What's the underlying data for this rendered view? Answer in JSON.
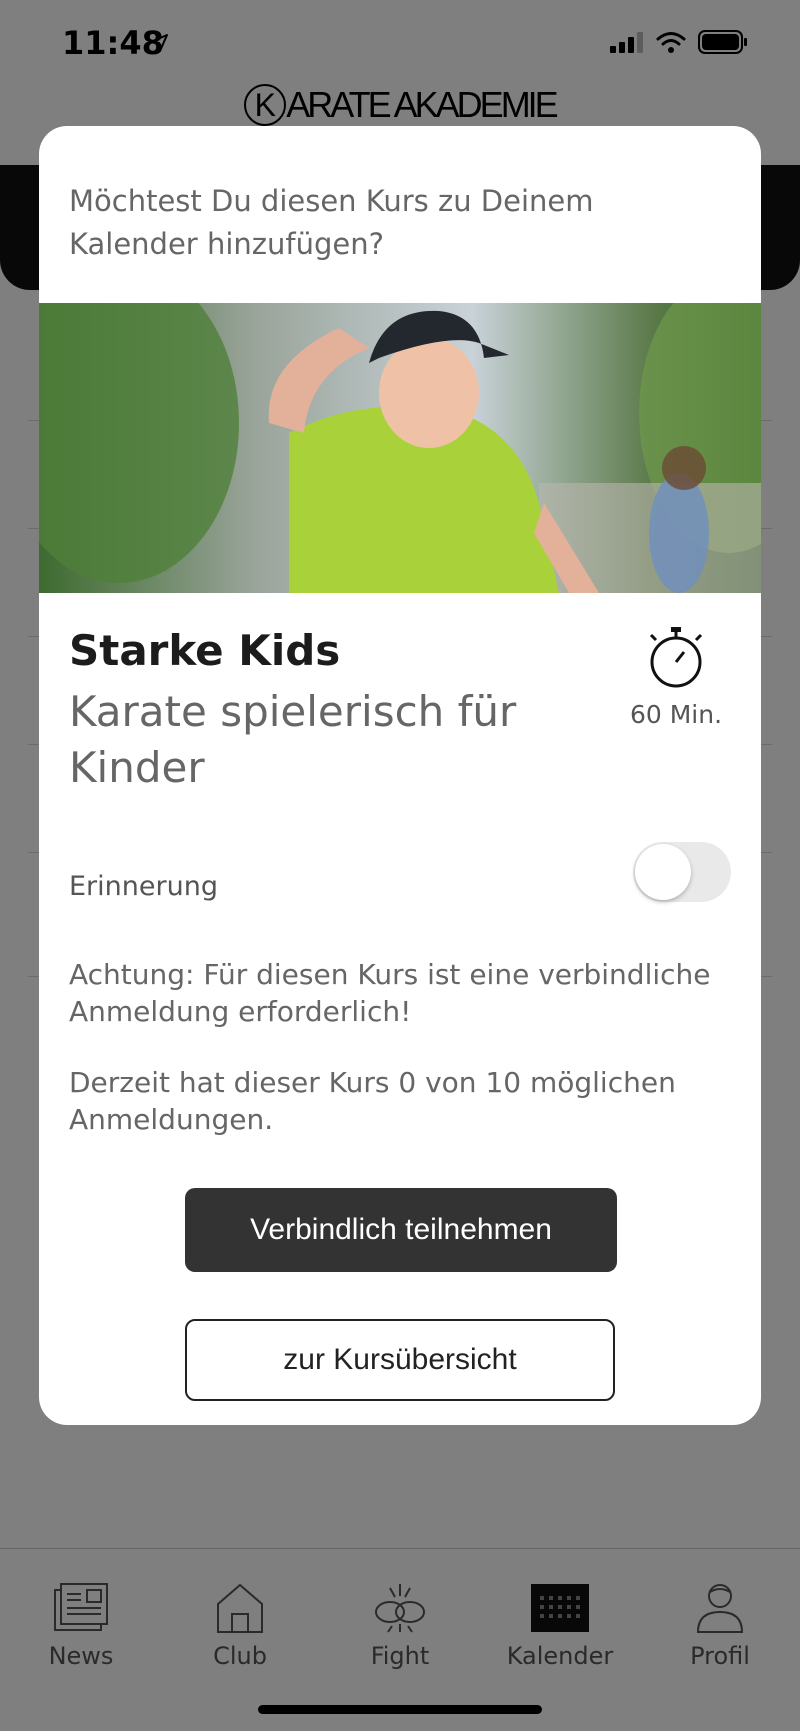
{
  "status_bar": {
    "time": "11:48"
  },
  "brand": {
    "logo_letter": "K",
    "logo_rest": "ARATE AKADEMIE"
  },
  "dialog": {
    "question": "Möchtest Du diesen Kurs zu Deinem Kalender hinzufügen?",
    "course_title": "Starke Kids",
    "course_subtitle": "Karate spielerisch für Kinder",
    "duration": "60 Min.",
    "reminder_label": "Erinnerung",
    "reminder_enabled": false,
    "notice": "Achtung: Für diesen Kurs ist eine verbindliche Anmeldung erforderlich!",
    "registrations_text": "Derzeit hat dieser Kurs 0 von 10 möglichen Anmeldungen.",
    "primary_button": "Verbindlich teilnehmen",
    "secondary_button": "zur Kursübersicht"
  },
  "tabbar": {
    "items": [
      {
        "label": "News",
        "icon": "newspaper-icon"
      },
      {
        "label": "Club",
        "icon": "house-icon"
      },
      {
        "label": "Fight",
        "icon": "gloves-icon"
      },
      {
        "label": "Kalender",
        "icon": "calendar-icon",
        "active": true
      },
      {
        "label": "Profil",
        "icon": "user-icon"
      }
    ]
  }
}
